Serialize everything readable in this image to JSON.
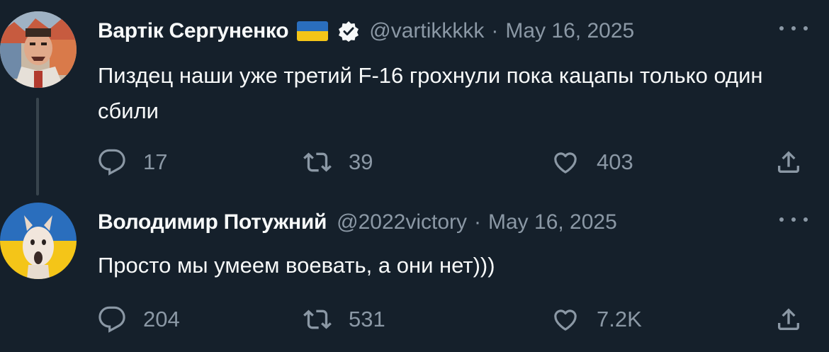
{
  "tweets": [
    {
      "author_name": "Вартiк Сергуненко",
      "handle": "@vartikkkkk",
      "separator": "·",
      "date": "May 16, 2025",
      "text": "Пиздец наши уже третий F-16 грохнули пока кацапы только один сбили",
      "replies": "17",
      "retweets": "39",
      "likes": "403"
    },
    {
      "author_name": "Володимир Потужний",
      "handle": "@2022victory",
      "separator": "·",
      "date": "May 16, 2025",
      "text": "Просто мы умеем воевать, а они нет)))",
      "replies": "204",
      "retweets": "531",
      "likes": "7.2K"
    }
  ],
  "icons": {
    "reply": "reply-icon",
    "retweet": "retweet-icon",
    "like": "heart-icon",
    "share": "share-icon",
    "more": "more-icon",
    "verified": "verified-badge-icon",
    "flag": "ukraine-flag-icon"
  },
  "colors": {
    "background": "#15202b",
    "text_primary": "#f7f9f9",
    "text_secondary": "#8b98a5",
    "thread_line": "#38444d"
  }
}
